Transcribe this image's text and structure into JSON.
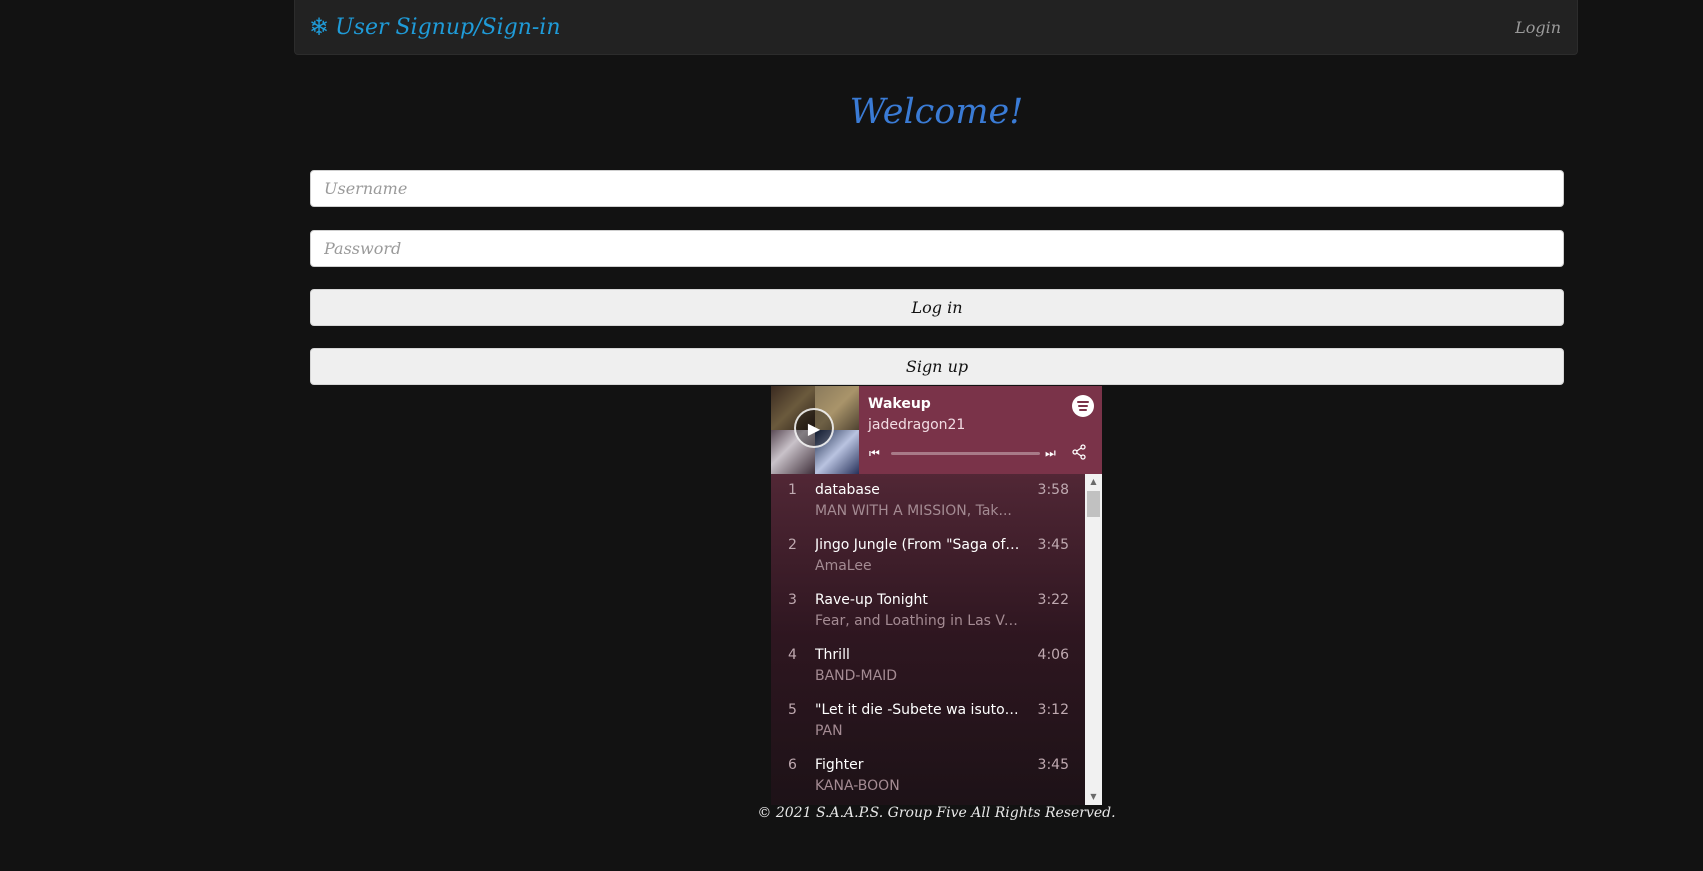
{
  "navbar": {
    "brand_icon": "❄",
    "brand_label": "User Signup/Sign-in",
    "login_label": "Login"
  },
  "main": {
    "welcome_title": "Welcome!",
    "username_placeholder": "Username",
    "password_placeholder": "Password",
    "login_button": "Log in",
    "signup_button": "Sign up"
  },
  "player": {
    "playlist_title": "Wakeup",
    "owner": "jadedragon21",
    "progress": 0,
    "tracks": [
      {
        "num": "1",
        "name": "database",
        "artist": "MAN WITH A MISSION, Tak...",
        "duration": "3:58"
      },
      {
        "num": "2",
        "name": "Jingo Jungle (From \"Saga of ...",
        "artist": "AmaLee",
        "duration": "3:45"
      },
      {
        "num": "3",
        "name": "Rave-up Tonight",
        "artist": "Fear, and Loathing in Las Veg...",
        "duration": "3:22"
      },
      {
        "num": "4",
        "name": "Thrill",
        "artist": "BAND-MAID",
        "duration": "4:06"
      },
      {
        "num": "5",
        "name": "\"Let it die -Subete wa isutori ...",
        "artist": "PAN",
        "duration": "3:12"
      },
      {
        "num": "6",
        "name": "Fighter",
        "artist": "KANA-BOON",
        "duration": "3:45"
      }
    ],
    "icons": {
      "play": "play-icon",
      "prev": "skip-back-icon",
      "next": "skip-forward-icon",
      "share": "share-icon",
      "logo": "spotify-logo-icon"
    }
  },
  "footer": {
    "copyright": "© 2021 S.A.A.P.S. Group Five All Rights Reserved."
  },
  "colors": {
    "background": "#121212",
    "navbar": "#222222",
    "brand": "#1f9bd8",
    "welcome": "#3a7bd5",
    "player_accent": "#7a3349"
  }
}
